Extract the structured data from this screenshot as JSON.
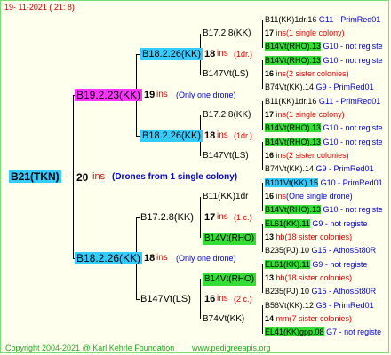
{
  "date": "19- 11-2021 ( 21: 8)",
  "copyright": "Copyright 2004-2021 @ Karl Kehrle Foundation",
  "site": "www.pedigreeapis.org",
  "root": {
    "name": "B21(TKN)",
    "count": "20",
    "ins": "ins",
    "note": "(Drones from 1 single colony)"
  },
  "gen1": [
    {
      "name": "B19.2.23(KK)",
      "count": "19",
      "ins": "ins",
      "note": "(Only one drone)"
    },
    {
      "name": "B18.2.26(KK)",
      "count": "18",
      "ins": "ins",
      "note": "(Only one drone)"
    }
  ],
  "gen2": [
    {
      "name": "B18.2.26(KK)",
      "count": "18",
      "ins": "ins",
      "note": "(1dr.)"
    },
    {
      "name": "B18.2.26(KK)",
      "count": "18",
      "ins": "ins",
      "note": "(1dr.)"
    },
    {
      "name": "B17.2.8(KK)",
      "count": "17",
      "ins": "ins",
      "note": "(1 c.)"
    },
    {
      "name": "B147Vt(LS)",
      "count": "16",
      "ins": "ins",
      "note": "(2 c.)"
    }
  ],
  "gen3": [
    {
      "name": "B17.2.8(KK)"
    },
    {
      "name": "B147Vt(LS)"
    },
    {
      "name": "B17.2.8(KK)"
    },
    {
      "name": "B147Vt(LS)"
    },
    {
      "name": "B11(KK)1dr"
    },
    {
      "name": "B14Vt(RHO)"
    },
    {
      "name": "B14Vt(RHO)"
    },
    {
      "name": "B74Vt(KK)"
    }
  ],
  "gen4": [
    {
      "name": "B11(KK)1dr.16",
      "suffix": "G11 - PrimRed01"
    },
    {
      "name": "17",
      "ins": "ins",
      "note": "(1 single colony)"
    },
    {
      "name": "B14Vt(RHO).13",
      "suffix": "G10 - not registe"
    },
    {
      "name": "B14Vt(RHO).13",
      "suffix": "G10 - not registe"
    },
    {
      "name": "16",
      "ins": "ins",
      "note": "(2 sister colonies)"
    },
    {
      "name": "B74Vt(KK).14",
      "suffix": "G9 - PrimRed01"
    },
    {
      "name": "B11(KK)1dr.16",
      "suffix": "G11 - PrimRed01"
    },
    {
      "name": "17",
      "ins": "ins",
      "note": "(1 single colony)"
    },
    {
      "name": "B14Vt(RHO).13",
      "suffix": "G10 - not registe"
    },
    {
      "name": "B14Vt(RHO).13",
      "suffix": "G10 - not registe"
    },
    {
      "name": "16",
      "ins": "ins",
      "note": "(2 sister colonies)"
    },
    {
      "name": "B74Vt(KK).14",
      "suffix": "G9 - PrimRed01"
    },
    {
      "name": "B101Vt(KK).15",
      "suffix": "G10 - PrimRed01"
    },
    {
      "name": "16",
      "ins": "ins",
      "note": "(One single drone)"
    },
    {
      "name": "B14Vt(RHO).13",
      "suffix": "G10 - not registe"
    },
    {
      "name": "EL61(KK).11",
      "suffix": "G9 - not registe"
    },
    {
      "name": "13",
      "ins": "hb",
      "note": "(18 sister colonies)"
    },
    {
      "name": "B235(PJ).10",
      "suffix": "G15 - AthosSt80R"
    },
    {
      "name": "EL61(KK).11",
      "suffix": "G9 - not registe"
    },
    {
      "name": "13",
      "ins": "hb",
      "note": "(18 sister colonies)"
    },
    {
      "name": "B235(PJ).10",
      "suffix": "G15 - AthosSt80R"
    },
    {
      "name": "B56Vt(KK).12",
      "suffix": "G8 - PrimRed01"
    },
    {
      "name": "14",
      "ins": "mm",
      "note": "(7 sister colonies)"
    },
    {
      "name": "EL41(KK)gpp.08",
      "suffix": "G7 - not registe"
    }
  ],
  "colors": {
    "cyan": "#33ccff",
    "magenta": "#ff33ff",
    "green": "#33dd33",
    "red": "#dd0000",
    "blue": "#0000cc",
    "text": "#000000"
  }
}
